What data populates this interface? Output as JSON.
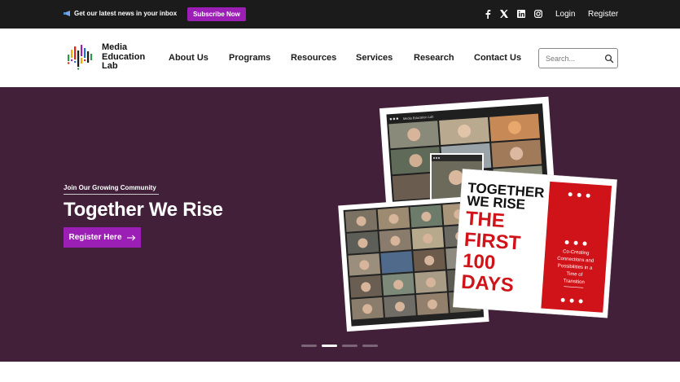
{
  "topbar": {
    "news_text": "Get our latest news in your inbox",
    "subscribe_label": "Subscribe Now",
    "login_label": "Login",
    "register_label": "Register",
    "social_icons": [
      "facebook-icon",
      "x-icon",
      "linkedin-icon",
      "instagram-icon"
    ]
  },
  "header": {
    "logo_line1": "Media",
    "logo_line2": "Education",
    "logo_line3": "Lab",
    "nav": [
      "About Us",
      "Programs",
      "Resources",
      "Services",
      "Research",
      "Contact Us"
    ],
    "search_placeholder": "Search..."
  },
  "hero": {
    "eyebrow": "Join Our Growing Community",
    "title": "Together We Rise",
    "cta_label": "Register Here",
    "card": {
      "line1": "TOGETHER",
      "line2": "WE RISE",
      "line3": "THE",
      "line4": "FIRST",
      "line5": "100",
      "line6": "DAYS",
      "side1": "Co-Creating",
      "side2": "Connections and",
      "side3": "Possibilities in a",
      "side4": "Time of",
      "side5": "Transition"
    },
    "window_title": "Media Education Lab",
    "slides": 4,
    "active_slide": 2
  },
  "colors": {
    "accent": "#9b1fb4",
    "hero_bg": "#42203a",
    "topbar_bg": "#1b1b1b",
    "card_red": "#d01318"
  }
}
